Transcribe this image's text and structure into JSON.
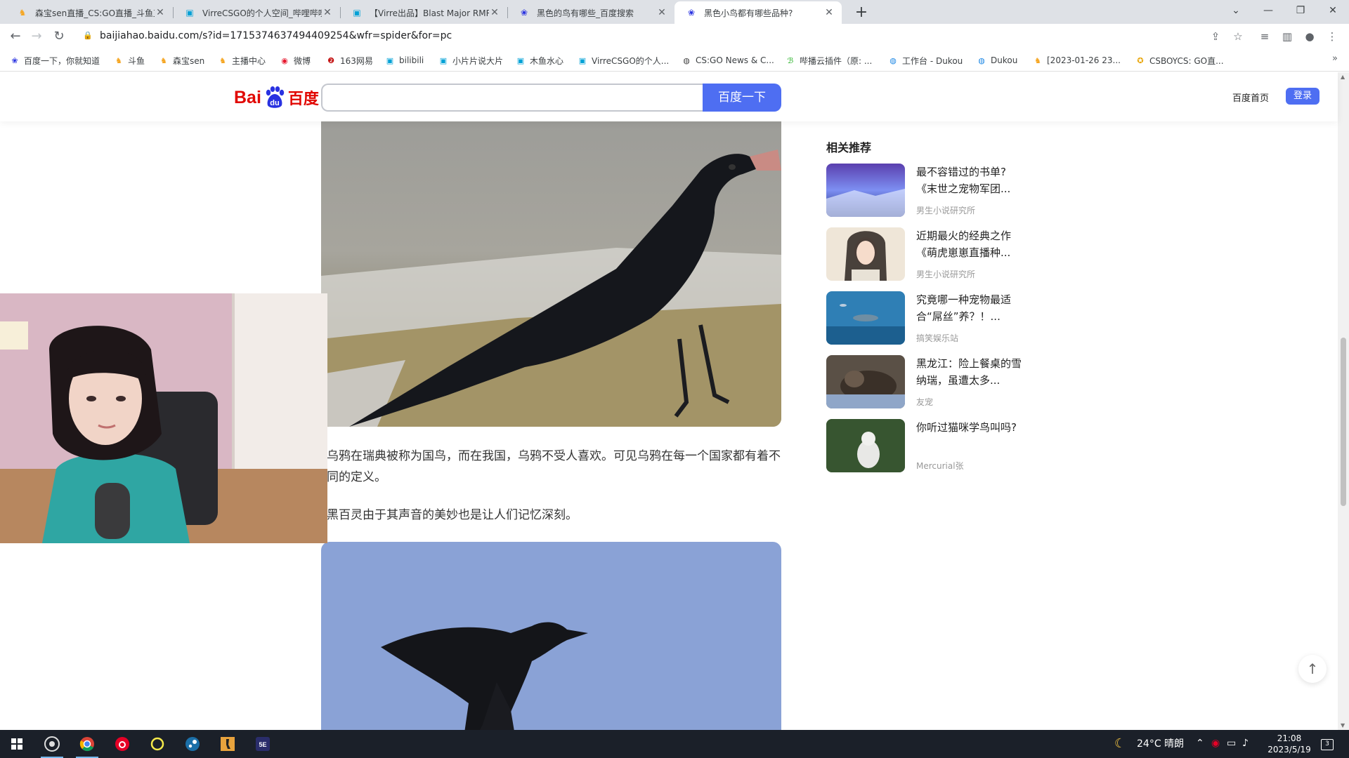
{
  "browser": {
    "tabs": [
      {
        "title": "森宝sen直播_CS:GO直播_斗鱼直",
        "icon": "douyu-icon",
        "active": false
      },
      {
        "title": "VirreCSGO的个人空间_哔哩哔哩",
        "icon": "bilibili-icon",
        "active": false
      },
      {
        "title": "【Virre出品】Blast Major RMR",
        "icon": "bilibili-icon",
        "active": false
      },
      {
        "title": "黑色的鸟有哪些_百度搜索",
        "icon": "baidu-icon",
        "active": false
      },
      {
        "title": "黑色小鸟都有哪些品种?",
        "icon": "baidu-icon",
        "active": true
      }
    ],
    "new_tab_label": "+",
    "url": "baijiahao.baidu.com/s?id=1715374637494409254&wfr=spider&for=pc",
    "bookmarks": [
      {
        "label": "百度一下，你就知道",
        "icon": "paw-icon"
      },
      {
        "label": "斗鱼",
        "icon": "douyu-icon"
      },
      {
        "label": "森宝sen",
        "icon": "douyu-icon"
      },
      {
        "label": "主播中心",
        "icon": "douyu-icon"
      },
      {
        "label": "微博",
        "icon": "weibo-icon"
      },
      {
        "label": "163网易",
        "icon": "netease-icon"
      },
      {
        "label": "bilibili",
        "icon": "bilibili-icon"
      },
      {
        "label": "小片片说大片",
        "icon": "bilibili-icon"
      },
      {
        "label": "木鱼水心",
        "icon": "bilibili-icon"
      },
      {
        "label": "VirreCSGO的个人...",
        "icon": "bilibili-icon"
      },
      {
        "label": "CS:GO News & C...",
        "icon": "globe-icon"
      },
      {
        "label": "哔播云插件（原: ...",
        "icon": "leaf-icon"
      },
      {
        "label": "工作台 - Dukou",
        "icon": "globe-icon"
      },
      {
        "label": "Dukou",
        "icon": "globe-icon"
      },
      {
        "label": "[2023-01-26 23...",
        "icon": "douyu-icon"
      },
      {
        "label": "CSBOYCS: GO直...",
        "icon": "badge-icon"
      }
    ]
  },
  "baidu": {
    "logo_latin": "Bai",
    "logo_cn": "百度",
    "search_placeholder": "",
    "search_button": "百度一下",
    "home_link": "百度首页",
    "login_button": "登录"
  },
  "article": {
    "paragraphs": [
      "乌鸦在瑞典被称为国鸟，而在我国，乌鸦不受人喜欢。可见乌鸦在每一个国家都有着不同的定义。",
      "黑百灵由于其声音的美妙也是让人们记忆深刻。"
    ]
  },
  "sidebar": {
    "title": "相关推荐",
    "items": [
      {
        "title": "最不容错过的书单?《末世之宠物军团...",
        "source": "男生小说研究所"
      },
      {
        "title": "近期最火的经典之作《萌虎崽崽直播种...",
        "source": "男生小说研究所"
      },
      {
        "title": "究竟哪一种宠物最适合“屌丝”养？！...",
        "source": "搞笑娱乐站"
      },
      {
        "title": "黑龙江：险上餐桌的雪纳瑞，虽遭太多...",
        "source": "友宠"
      },
      {
        "title": "你听过猫咪学鸟叫吗?",
        "source": "Mercurial张"
      }
    ]
  },
  "taskbar": {
    "weather": "24°C  晴朗",
    "time": "21:08",
    "date": "2023/5/19",
    "notification_count": "3"
  },
  "colors": {
    "baidu_blue": "#4e6ef2",
    "baidu_red": "#e10601",
    "tabbar_bg": "#dee1e6",
    "taskbar_bg": "#1b2029"
  }
}
